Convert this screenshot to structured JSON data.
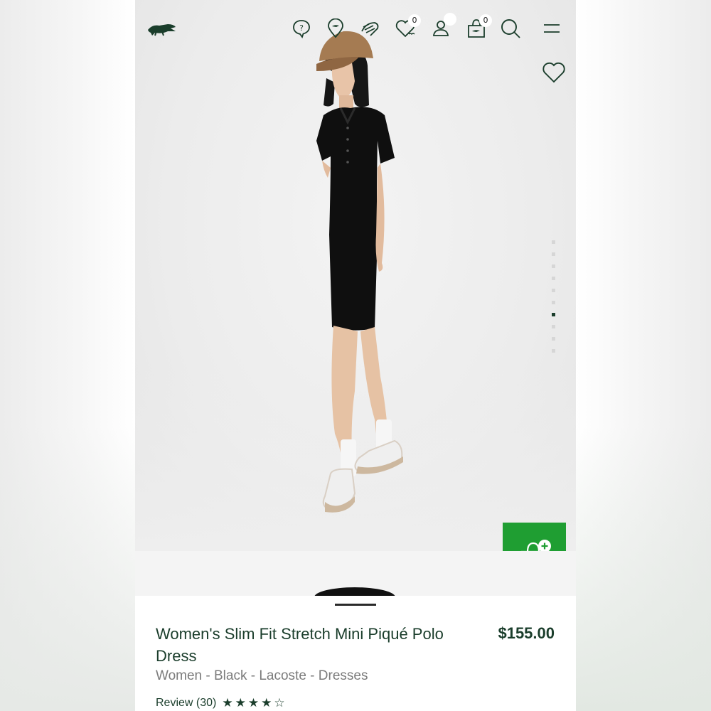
{
  "header": {
    "logo_name": "lacoste-crocodile-logo",
    "icons": [
      "help-chat-icon",
      "store-locator-icon",
      "club-icon",
      "wishlist-icon",
      "account-icon",
      "cart-icon",
      "search-icon",
      "menu-icon"
    ],
    "wishlist_count": "0",
    "cart_count": "0"
  },
  "gallery": {
    "image_count": 10,
    "active_index": 6
  },
  "add_to_bag": {
    "icon": "add-to-bag-icon"
  },
  "product": {
    "title": "Women's Slim Fit Stretch Mini Piqué Polo Dress",
    "price": "$155.00",
    "breadcrumb": "Women - Black - Lacoste - Dresses",
    "review_label": "Review (30)",
    "rating": 4,
    "rating_max": 5
  },
  "colors": {
    "brand_green": "#1a3d2b",
    "cta_green": "#1f9e32"
  }
}
